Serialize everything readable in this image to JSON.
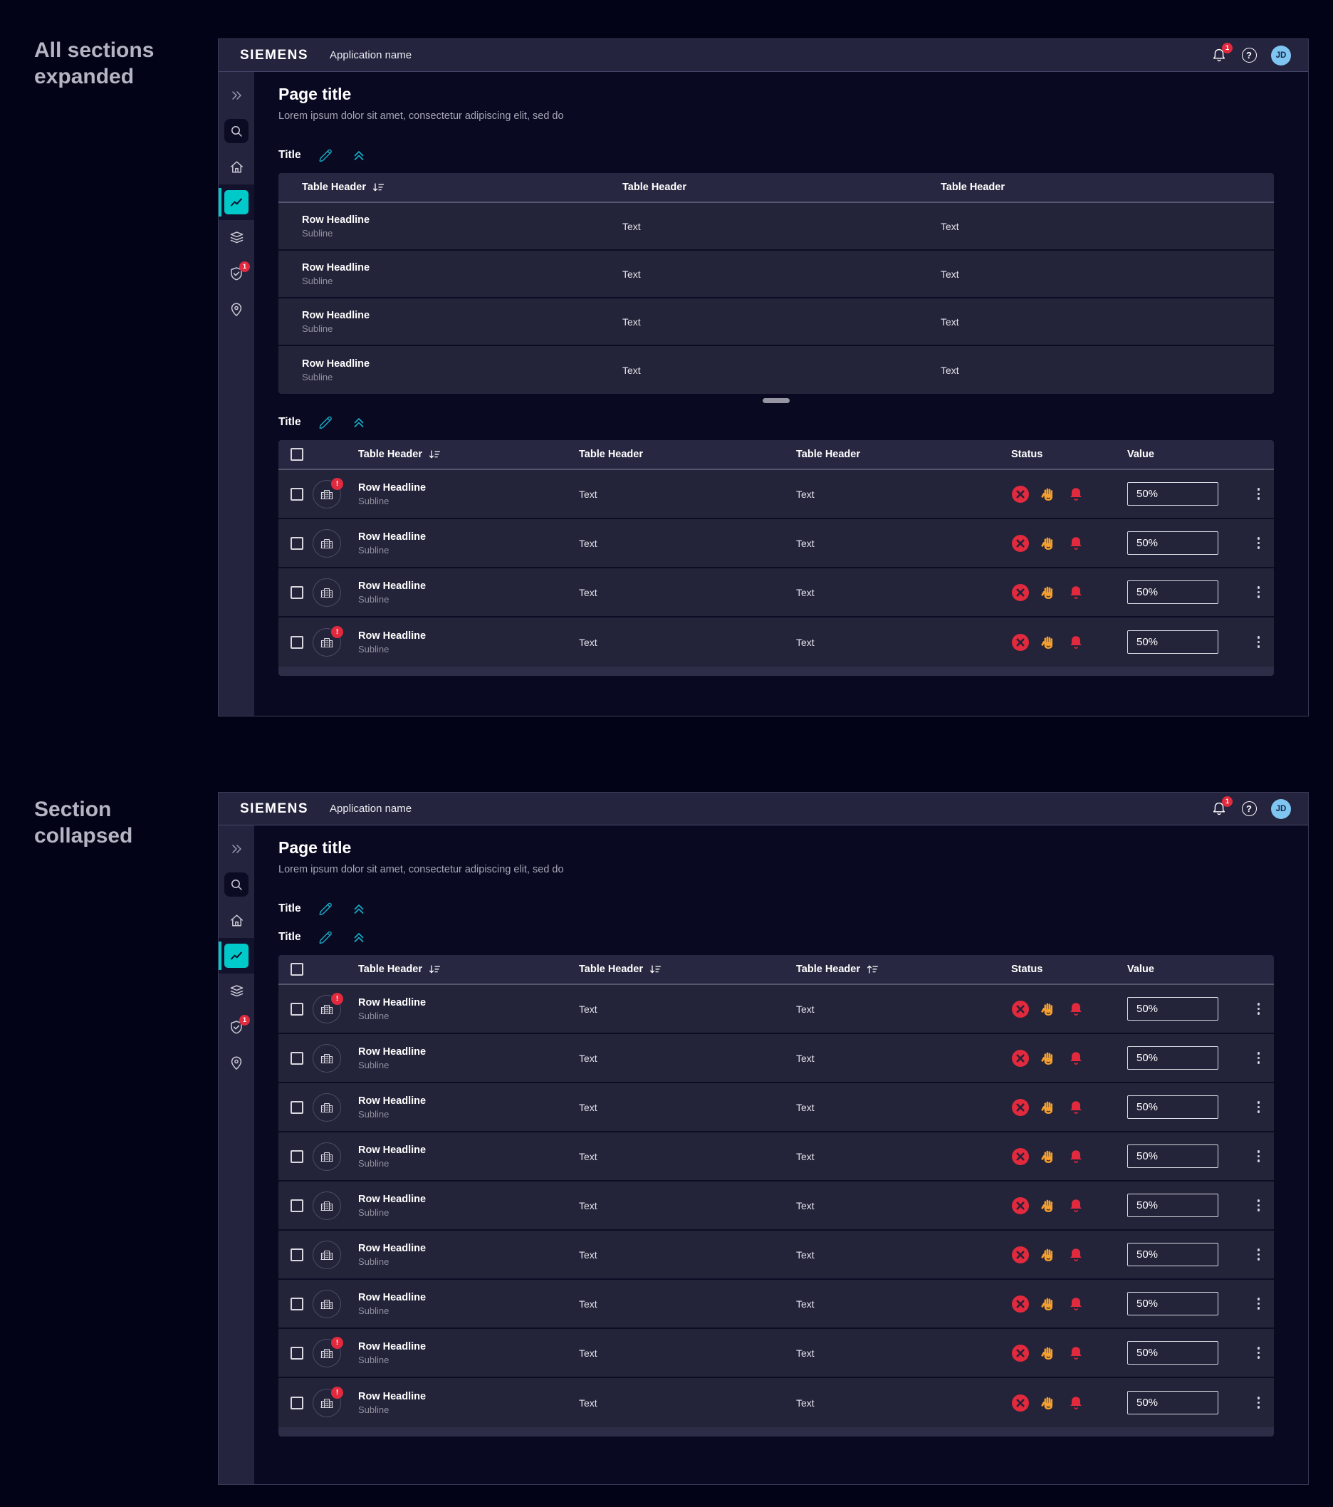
{
  "annotations": {
    "expanded": "All sections expanded",
    "collapsed": "Section collapsed"
  },
  "colors": {
    "accent_teal": "#00C9C9",
    "icon_teal": "#16AEC6",
    "alert_red": "#E12A3D",
    "warning_orange": "#F5A02E",
    "avatar_blue": "#7FC5F2"
  },
  "chrome": {
    "logo": "SIEMENS",
    "app_name": "Application name",
    "notification_count": "1",
    "help_glyph": "?",
    "avatar_initials": "JD"
  },
  "sidebar": {
    "security_badge": "1"
  },
  "content": {
    "page_title": "Page title",
    "page_subtitle": "Lorem ipsum dolor sit amet, consectetur adipiscing elit, sed do",
    "section_title": "Title"
  },
  "tables": {
    "simple": {
      "headers": [
        {
          "label": "Table Header",
          "sort_desc": true
        },
        {
          "label": "Table Header"
        },
        {
          "label": "Table Header"
        }
      ],
      "rows": [
        {
          "headline": "Row Headline",
          "subline": "Subline",
          "col2": "Text",
          "col3": "Text"
        },
        {
          "headline": "Row Headline",
          "subline": "Subline",
          "col2": "Text",
          "col3": "Text"
        },
        {
          "headline": "Row Headline",
          "subline": "Subline",
          "col2": "Text",
          "col3": "Text"
        },
        {
          "headline": "Row Headline",
          "subline": "Subline",
          "col2": "Text",
          "col3": "Text"
        }
      ]
    },
    "expanded_complex": {
      "headers": [
        {
          "label": "Table Header",
          "sort_desc": true
        },
        {
          "label": "Table Header"
        },
        {
          "label": "Table Header"
        }
      ],
      "status_header": "Status",
      "value_header": "Value",
      "rows": [
        {
          "headline": "Row Headline",
          "subline": "Subline",
          "col2": "Text",
          "col3": "Text",
          "value": "50%",
          "alert": true,
          "alert_text": "!"
        },
        {
          "headline": "Row Headline",
          "subline": "Subline",
          "col2": "Text",
          "col3": "Text",
          "value": "50%",
          "alert": false,
          "alert_text": "!"
        },
        {
          "headline": "Row Headline",
          "subline": "Subline",
          "col2": "Text",
          "col3": "Text",
          "value": "50%",
          "alert": false,
          "alert_text": "!"
        },
        {
          "headline": "Row Headline",
          "subline": "Subline",
          "col2": "Text",
          "col3": "Text",
          "value": "50%",
          "alert": true,
          "alert_text": "!"
        }
      ]
    },
    "collapsed_complex": {
      "headers": [
        {
          "label": "Table Header",
          "sort_desc": true
        },
        {
          "label": "Table Header",
          "sort_desc": true
        },
        {
          "label": "Table Header",
          "sort_asc": true
        }
      ],
      "status_header": "Status",
      "value_header": "Value",
      "rows": [
        {
          "headline": "Row Headline",
          "subline": "Subline",
          "col2": "Text",
          "col3": "Text",
          "value": "50%",
          "alert": true,
          "alert_text": "!"
        },
        {
          "headline": "Row Headline",
          "subline": "Subline",
          "col2": "Text",
          "col3": "Text",
          "value": "50%",
          "alert": false,
          "alert_text": "!"
        },
        {
          "headline": "Row Headline",
          "subline": "Subline",
          "col2": "Text",
          "col3": "Text",
          "value": "50%",
          "alert": false,
          "alert_text": "!"
        },
        {
          "headline": "Row Headline",
          "subline": "Subline",
          "col2": "Text",
          "col3": "Text",
          "value": "50%",
          "alert": false,
          "alert_text": "!"
        },
        {
          "headline": "Row Headline",
          "subline": "Subline",
          "col2": "Text",
          "col3": "Text",
          "value": "50%",
          "alert": false,
          "alert_text": "!"
        },
        {
          "headline": "Row Headline",
          "subline": "Subline",
          "col2": "Text",
          "col3": "Text",
          "value": "50%",
          "alert": false,
          "alert_text": "!"
        },
        {
          "headline": "Row Headline",
          "subline": "Subline",
          "col2": "Text",
          "col3": "Text",
          "value": "50%",
          "alert": false,
          "alert_text": "!"
        },
        {
          "headline": "Row Headline",
          "subline": "Subline",
          "col2": "Text",
          "col3": "Text",
          "value": "50%",
          "alert": true,
          "alert_text": "!"
        },
        {
          "headline": "Row Headline",
          "subline": "Subline",
          "col2": "Text",
          "col3": "Text",
          "value": "50%",
          "alert": true,
          "alert_text": "!"
        }
      ]
    }
  }
}
